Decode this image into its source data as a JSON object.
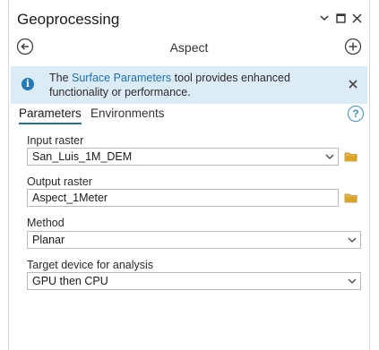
{
  "window": {
    "title": "Geoprocessing"
  },
  "tool": {
    "title": "Aspect"
  },
  "banner": {
    "text_before": "The ",
    "link": "Surface Parameters",
    "text_after": " tool provides enhanced functionality or performance."
  },
  "tabs": [
    {
      "label": "Parameters",
      "active": true
    },
    {
      "label": "Environments",
      "active": false
    }
  ],
  "fields": {
    "input_raster": {
      "label": "Input raster",
      "value": "San_Luis_1M_DEM"
    },
    "output_raster": {
      "label": "Output raster",
      "value": "Aspect_1Meter"
    },
    "method": {
      "label": "Method",
      "value": "Planar"
    },
    "target_device": {
      "label": "Target device for analysis",
      "value": "GPU then CPU"
    }
  },
  "colors": {
    "accent": "#1f6fb5",
    "banner_bg": "#dcecf7",
    "folder": "#d8a52a"
  },
  "icons": [
    "chevron-down-icon",
    "maximize-icon",
    "close-icon",
    "back-arrow-icon",
    "add-icon",
    "info-icon",
    "help-icon",
    "folder-icon"
  ]
}
